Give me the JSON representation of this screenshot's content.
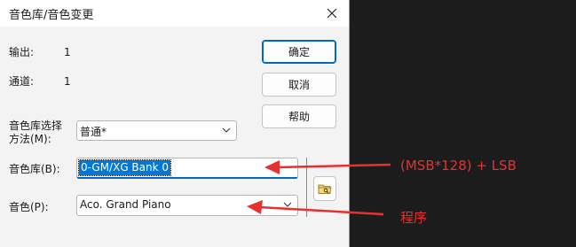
{
  "dialog": {
    "title": "音色库/音色变更",
    "output_label": "输出:",
    "output_value": "1",
    "channel_label": "通道:",
    "channel_value": "1",
    "select_method_label_line1": "音色库选择",
    "select_method_label_line2": "方法(M):",
    "select_method_value": "普通*",
    "bank_label": "音色库(B):",
    "bank_value": "0-GM/XG Bank 0",
    "program_label": "音色(P):",
    "program_value": "Aco. Grand Piano",
    "buttons": {
      "ok": "确定",
      "cancel": "取消",
      "help": "帮助"
    }
  },
  "annotations": {
    "bank_note": "(MSB*128) + LSB",
    "program_note": "程序"
  },
  "colors": {
    "accent": "#0067c0",
    "selection": "#0078d7",
    "annotation": "#e83030",
    "dialog_bg": "#f3f3f3",
    "background": "#1c1c1c"
  }
}
